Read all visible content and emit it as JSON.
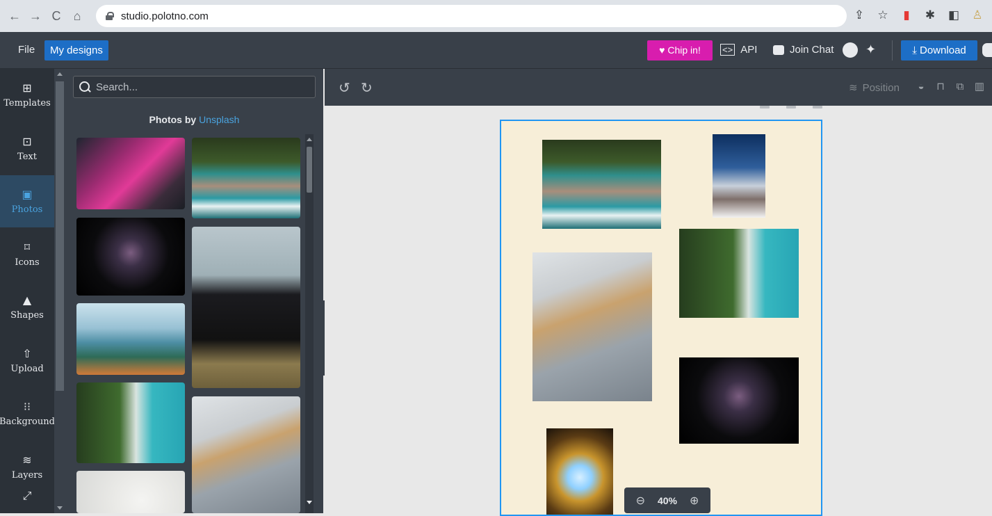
{
  "browser": {
    "url": "studio.polotno.com",
    "nav": [
      "←",
      "→",
      "C",
      "⌂"
    ]
  },
  "topbar": {
    "file": "File",
    "my_designs": "My designs",
    "chip_in": "Chip in!",
    "api": "API",
    "join_chat": "Join Chat",
    "download": "Download"
  },
  "sidebar": {
    "items": [
      {
        "label": "Templates",
        "icon": "⊞"
      },
      {
        "label": "Text",
        "icon": "⊡"
      },
      {
        "label": "Photos",
        "icon": "▣"
      },
      {
        "label": "Icons",
        "icon": "⌑"
      },
      {
        "label": "Shapes",
        "icon": "▲"
      },
      {
        "label": "Upload",
        "icon": "⇧"
      },
      {
        "label": "Background",
        "icon": "⁝⁝"
      },
      {
        "label": "Layers",
        "icon": "≋"
      }
    ],
    "more_icon": "⤢"
  },
  "panel": {
    "search_placeholder": "Search...",
    "photos_prefix": "Photos by ",
    "photos_link": "Unsplash"
  },
  "toolbar": {
    "undo": "↺",
    "redo": "↻",
    "position": "Position"
  },
  "zoom": {
    "level": "40%",
    "minus": "⊖",
    "plus": "⊕"
  },
  "colors": {
    "accent_blue": "#1d6ec6",
    "chip_pink": "#d81dae",
    "page_bg": "#f7eed8",
    "selection": "#2196f3"
  }
}
